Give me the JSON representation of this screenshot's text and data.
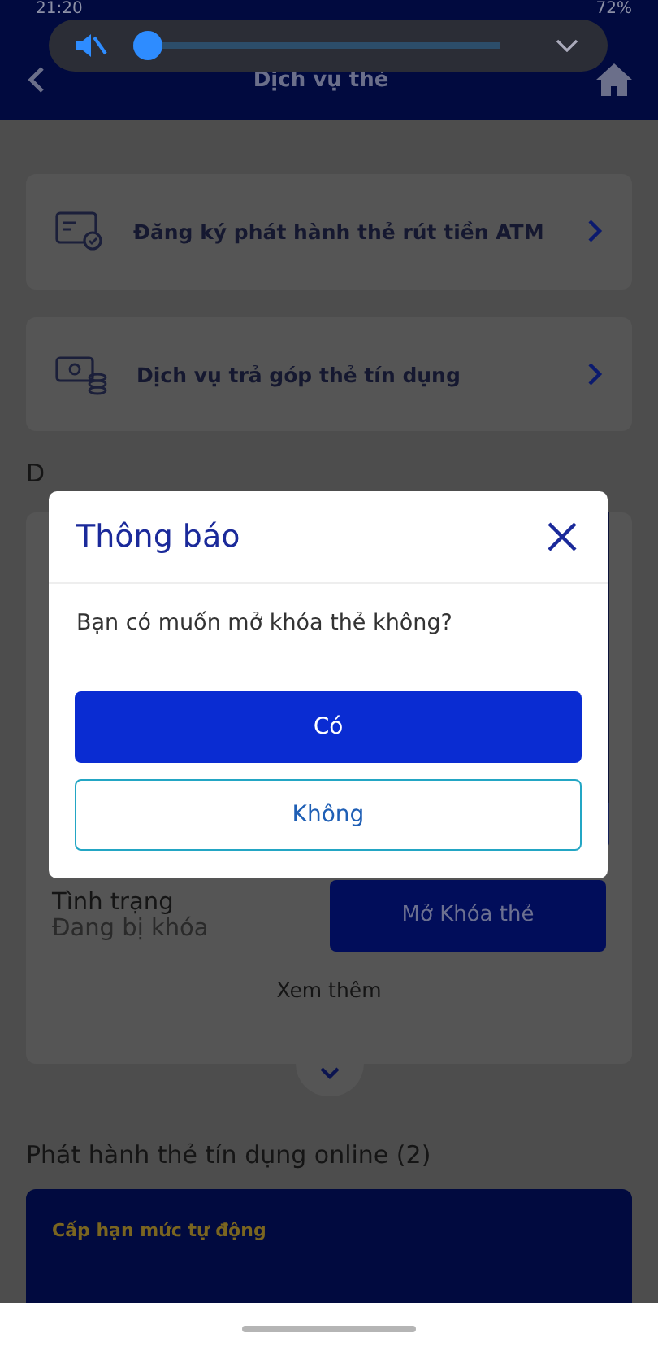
{
  "status_bar": {
    "time": "21:20",
    "battery": "72%"
  },
  "volume_panel": {
    "muted": true,
    "level": 0
  },
  "header": {
    "title": "Dịch vụ thẻ"
  },
  "services": [
    {
      "label": "Đăng ký phát hành thẻ rút tiền ATM",
      "kind": "card"
    },
    {
      "label": "Dịch vụ trả góp thẻ tín dụng",
      "kind": "cash"
    }
  ],
  "my_cards": {
    "title": "D",
    "status_label": "Tình trạng",
    "status_value": "Đang bị khóa",
    "action": "Mở Khóa thẻ",
    "more": "Xem thêm"
  },
  "online_issue": {
    "title": "Phát hành thẻ tín dụng online (2)",
    "promo": "Cấp hạn mức tự động"
  },
  "dialog": {
    "title": "Thông báo",
    "message": "Bạn có muốn mở khóa thẻ không?",
    "buttons": [
      {
        "label": "Có",
        "kind": "primary"
      },
      {
        "label": "Không",
        "kind": "secondary"
      }
    ]
  }
}
